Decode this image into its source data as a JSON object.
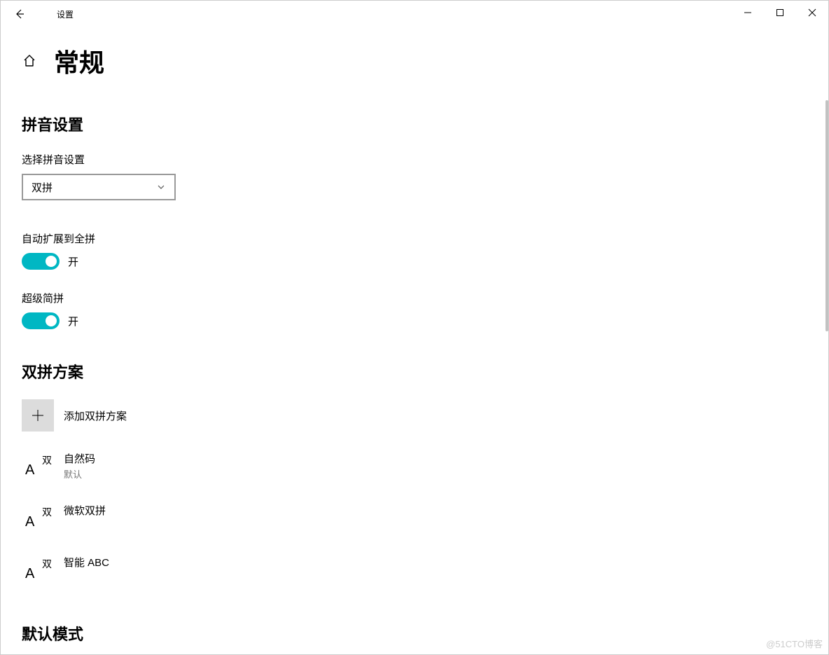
{
  "window": {
    "title": "设置"
  },
  "page": {
    "title": "常规"
  },
  "section_pinyin": {
    "title": "拼音设置",
    "select_label": "选择拼音设置",
    "select_value": "双拼",
    "toggle1_label": "自动扩展到全拼",
    "toggle1_state": "开",
    "toggle2_label": "超级简拼",
    "toggle2_state": "开"
  },
  "section_scheme": {
    "title": "双拼方案",
    "add_label": "添加双拼方案",
    "items": [
      {
        "name": "自然码",
        "sub": "默认"
      },
      {
        "name": "微软双拼",
        "sub": ""
      },
      {
        "name": "智能 ABC",
        "sub": ""
      }
    ]
  },
  "section_default": {
    "title": "默认模式"
  },
  "watermark": "@51CTO博客",
  "glyphs": {
    "A": "A",
    "shuang": "双"
  }
}
